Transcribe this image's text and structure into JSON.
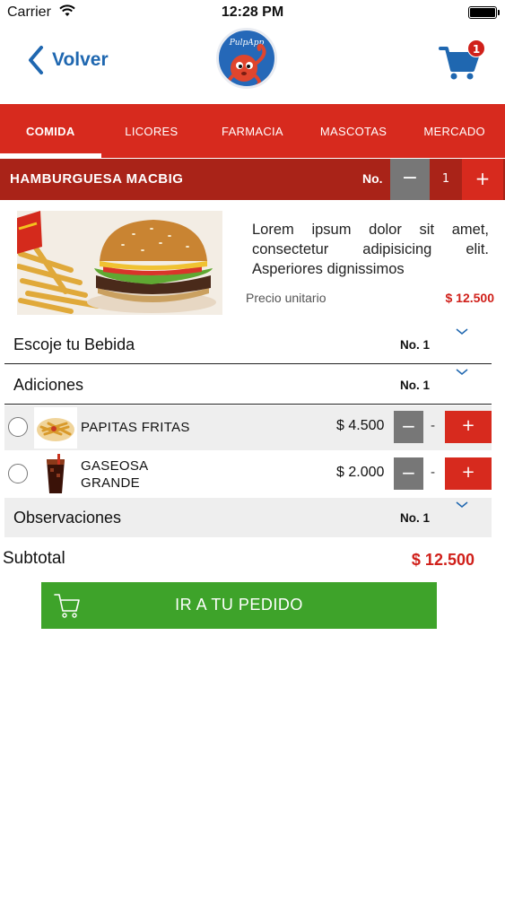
{
  "status_bar": {
    "carrier": "Carrier",
    "time": "12:28 PM"
  },
  "nav": {
    "back_label": "Volver",
    "brand": "PulpApp",
    "cart_count": "1"
  },
  "tabs": [
    {
      "label": "COMIDA",
      "active": true
    },
    {
      "label": "LICORES"
    },
    {
      "label": "FARMACIA"
    },
    {
      "label": "MASCOTAS"
    },
    {
      "label": "MERCADO"
    }
  ],
  "product": {
    "name": "HAMBURGUESA MACBIG",
    "qty_label": "No.",
    "minus": "−",
    "qty": "1",
    "plus": "+",
    "description": "Lorem ipsum dolor sit amet, consectetur adipisicing elit. Asperiores dignissimos",
    "unit_price_label": "Precio unitario",
    "unit_price": "$ 12.500"
  },
  "sections": {
    "bebida": {
      "title": "Escoje tu Bebida",
      "no": "No. 1"
    },
    "adiciones": {
      "title": "Adiciones",
      "no": "No. 1"
    },
    "observaciones": {
      "title": "Observaciones",
      "no": "No. 1"
    }
  },
  "additions": [
    {
      "label": "PAPITAS FRITAS",
      "price": "$ 4.500",
      "minus": "−",
      "dash": "-",
      "plus": "+"
    },
    {
      "label_line1": "GASEOSA",
      "label_line2": "GRANDE",
      "price": "$ 2.000",
      "minus": "−",
      "dash": "-",
      "plus": "+"
    }
  ],
  "subtotal": {
    "label": "Subtotal",
    "value": "$ 12.500"
  },
  "cta": {
    "label": "IR A TU PEDIDO"
  },
  "colors": {
    "brand_red": "#d72a1e",
    "dark_red": "#a92318",
    "accent_blue": "#1f67b0",
    "cta_green": "#3ea32a",
    "price_red": "#d0201a"
  }
}
